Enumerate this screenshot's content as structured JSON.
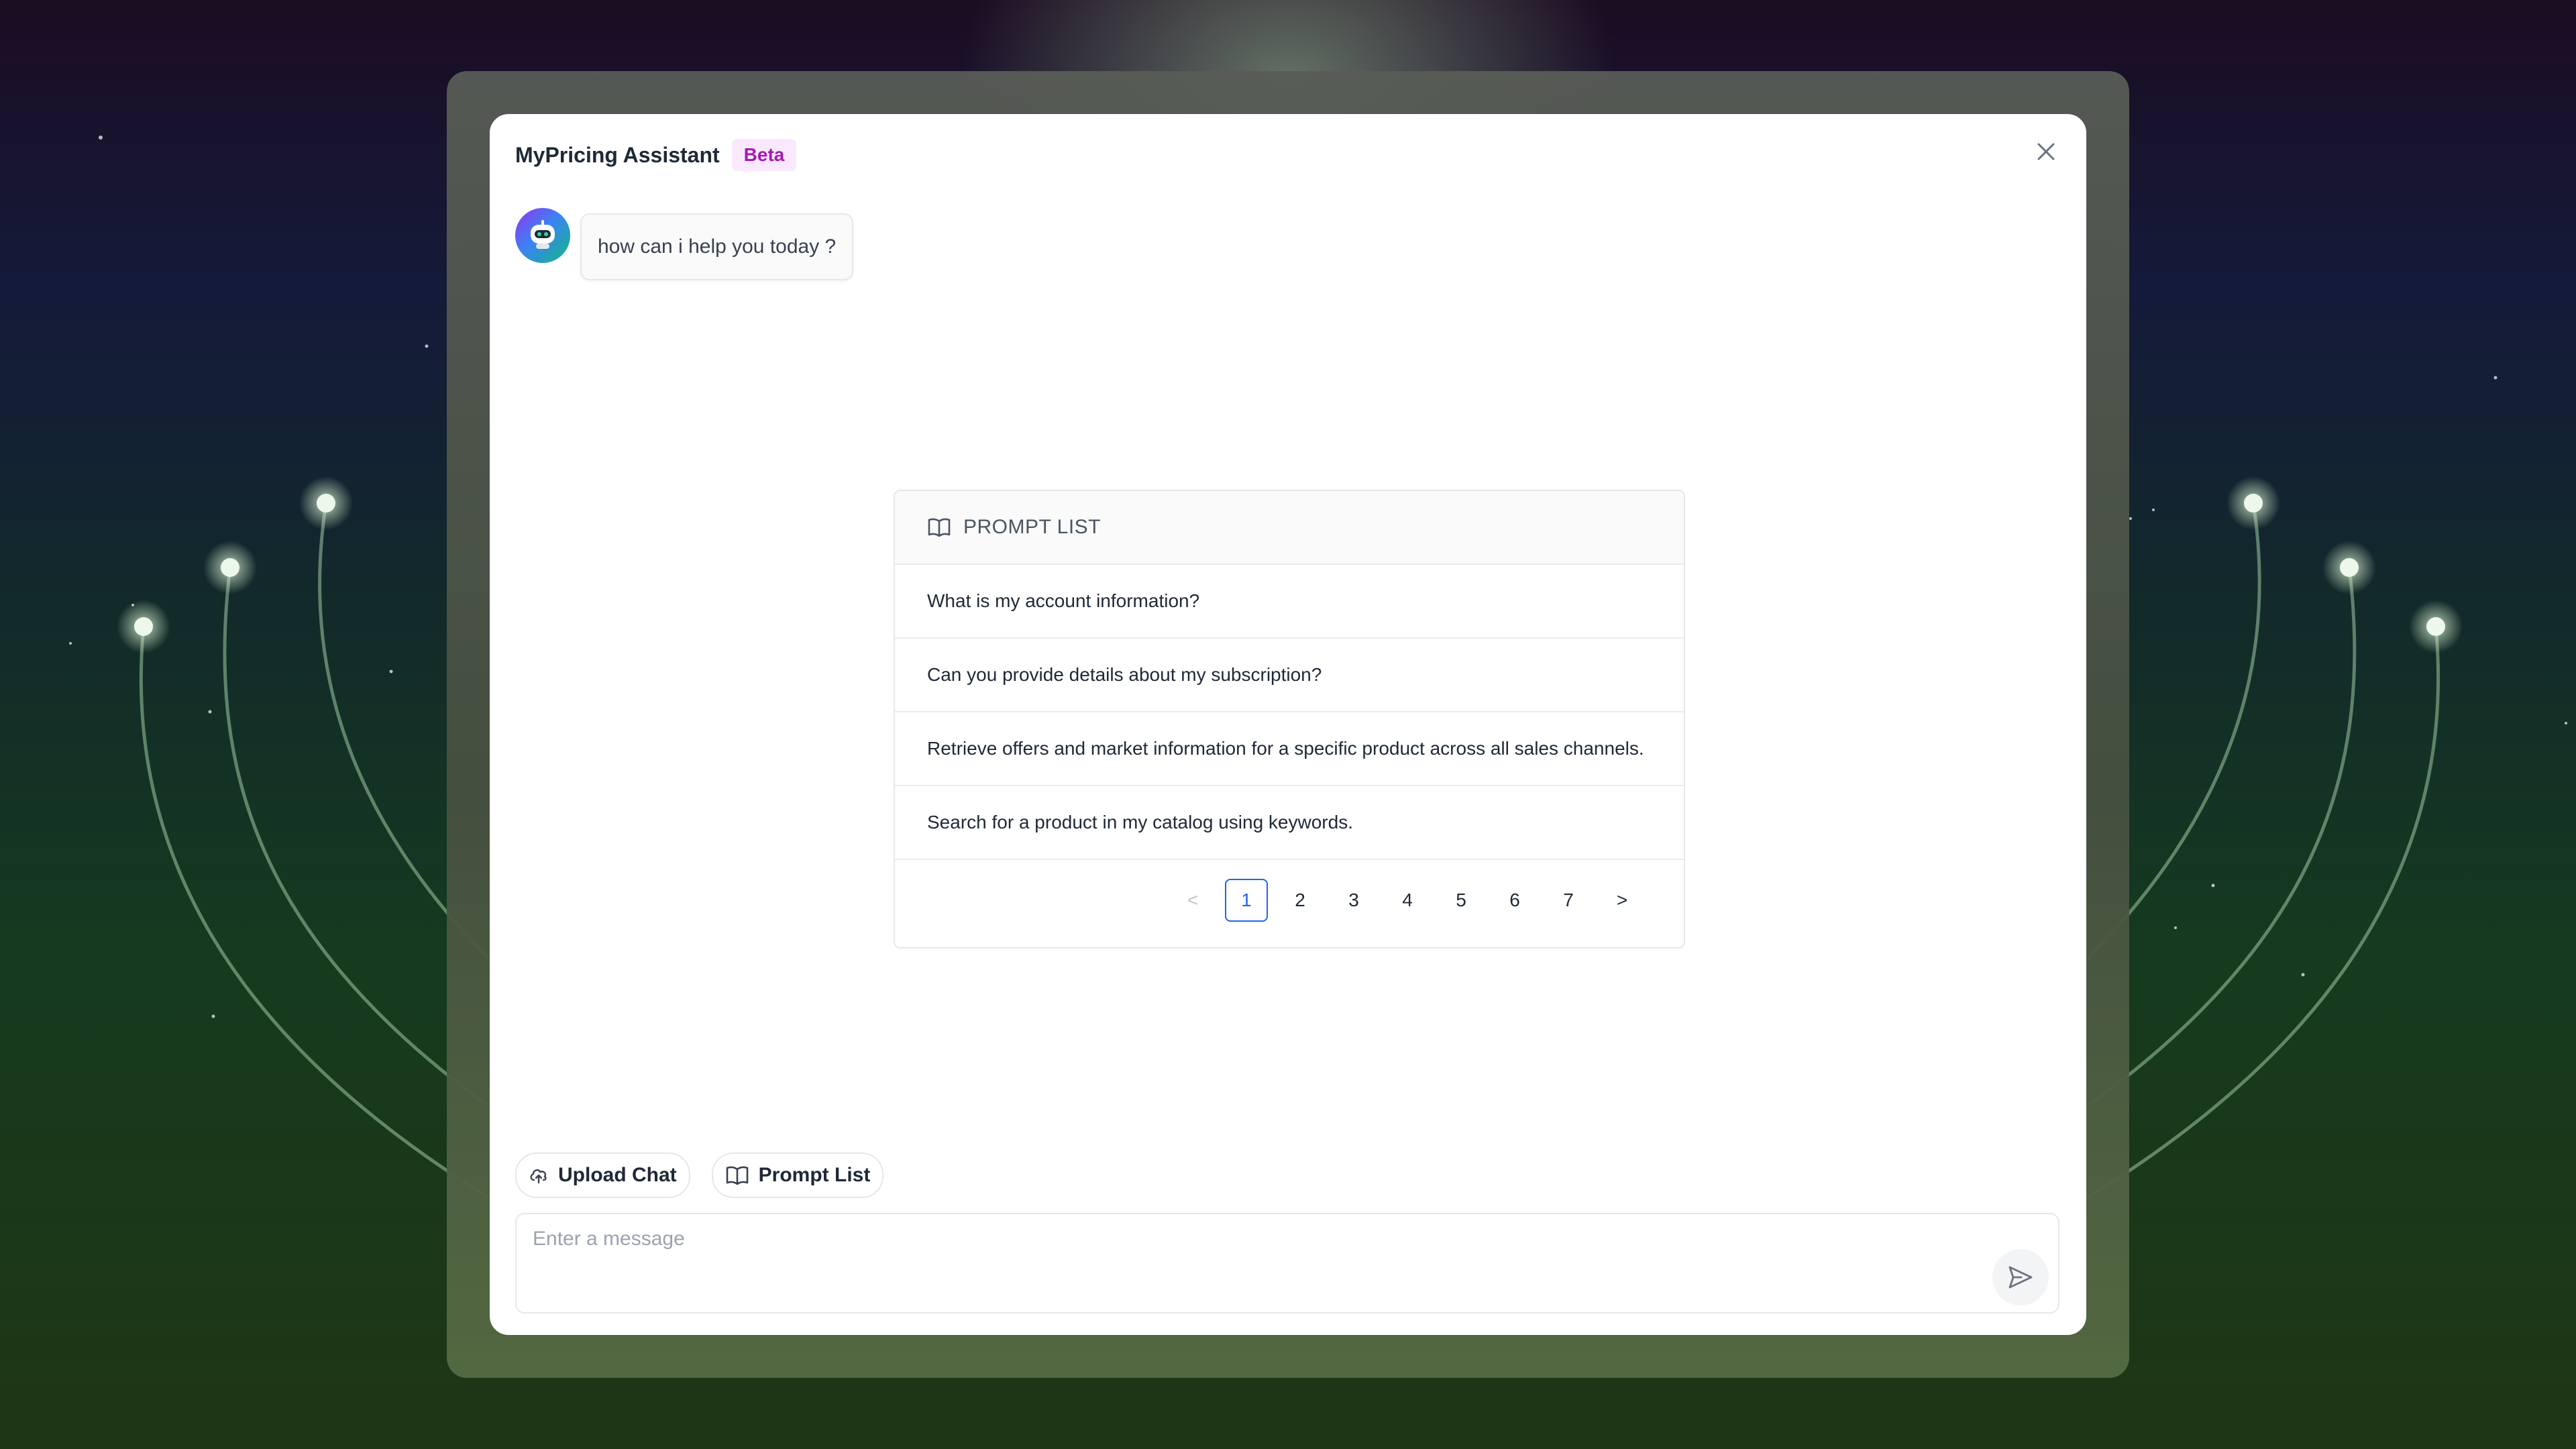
{
  "dialog": {
    "title": "MyPricing Assistant",
    "badge": "Beta",
    "close_icon": "close-icon"
  },
  "chat": {
    "assistant_avatar_icon": "robot-icon",
    "messages": [
      {
        "role": "assistant",
        "text": "how can i help you today ?"
      }
    ]
  },
  "prompt_list": {
    "header_icon": "book-open-icon",
    "header": "PROMPT LIST",
    "items": [
      "What is my account information?",
      "Can you provide details about my subscription?",
      "Retrieve offers and market information for a specific product across all sales channels.",
      "Search for a product in my catalog using keywords."
    ],
    "pagination": {
      "prev_symbol": "<",
      "next_symbol": ">",
      "pages": [
        "1",
        "2",
        "3",
        "4",
        "5",
        "6",
        "7"
      ],
      "current": "1"
    }
  },
  "actions": {
    "upload_chat": {
      "label": "Upload Chat",
      "icon": "cloud-upload-icon"
    },
    "prompt_list": {
      "label": "Prompt List",
      "icon": "book-open-icon"
    }
  },
  "composer": {
    "placeholder": "Enter a message",
    "value": "",
    "send_icon": "send-icon"
  },
  "colors": {
    "accent": "#2563eb",
    "badge_text": "#a21caf",
    "badge_bg": "#fae8ff"
  }
}
